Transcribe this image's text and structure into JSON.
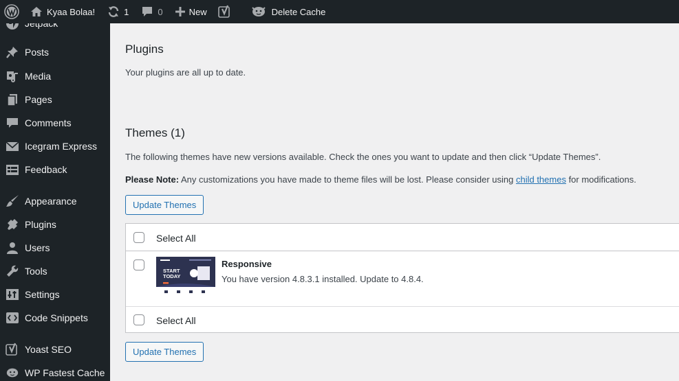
{
  "adminbar": {
    "site_name": "Kyaa Bolaa!",
    "updates_count": "1",
    "comments_count": "0",
    "new_label": "New",
    "delete_cache_label": "Delete Cache"
  },
  "sidebar": {
    "items": [
      {
        "label": "Jetpack",
        "icon": "jetpack-icon"
      },
      {
        "label": "Posts",
        "icon": "pushpin-icon"
      },
      {
        "label": "Media",
        "icon": "media-icon"
      },
      {
        "label": "Pages",
        "icon": "pages-icon"
      },
      {
        "label": "Comments",
        "icon": "comment-icon"
      },
      {
        "label": "Icegram Express",
        "icon": "envelope-icon"
      },
      {
        "label": "Feedback",
        "icon": "feedback-icon"
      },
      {
        "label": "Appearance",
        "icon": "paintbrush-icon"
      },
      {
        "label": "Plugins",
        "icon": "plug-icon"
      },
      {
        "label": "Users",
        "icon": "user-icon"
      },
      {
        "label": "Tools",
        "icon": "wrench-icon"
      },
      {
        "label": "Settings",
        "icon": "sliders-icon"
      },
      {
        "label": "Code Snippets",
        "icon": "code-icon"
      },
      {
        "label": "Yoast SEO",
        "icon": "yoast-icon"
      },
      {
        "label": "WP Fastest Cache",
        "icon": "cheetah-icon"
      }
    ]
  },
  "plugins": {
    "heading": "Plugins",
    "message": "Your plugins are all up to date."
  },
  "themes": {
    "heading": "Themes (1)",
    "description": "The following themes have new versions available. Check the ones you want to update and then click “Update Themes”.",
    "note_label": "Please Note:",
    "note_text": " Any customizations you have made to theme files will be lost. Please consider using ",
    "note_link": "child themes",
    "note_end": " for modifications.",
    "update_button": "Update Themes",
    "select_all": "Select All",
    "theme": {
      "name": "Responsive",
      "info": "You have version 4.8.3.1 installed. Update to 4.8.4.",
      "thumb_text_1": "START",
      "thumb_text_2": "TODAY"
    }
  }
}
